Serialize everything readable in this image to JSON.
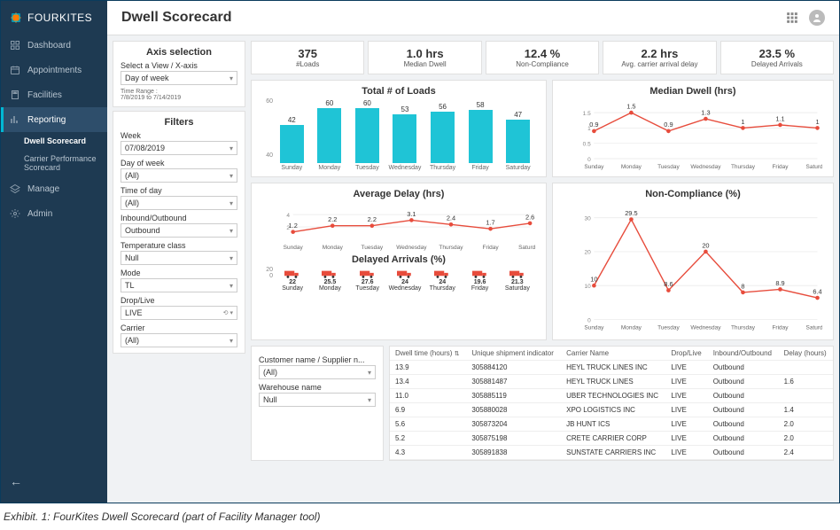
{
  "brand": "FOURKITES",
  "header": {
    "title": "Dwell Scorecard"
  },
  "nav": {
    "items": [
      {
        "label": "Dashboard",
        "icon": "dashboard"
      },
      {
        "label": "Appointments",
        "icon": "calendar"
      },
      {
        "label": "Facilities",
        "icon": "building"
      },
      {
        "label": "Reporting",
        "icon": "chart",
        "active": true
      },
      {
        "label": "Manage",
        "icon": "layers"
      },
      {
        "label": "Admin",
        "icon": "gear"
      }
    ],
    "sub_reporting": [
      {
        "label": "Dwell Scorecard",
        "active": true
      },
      {
        "label": "Carrier Performance Scorecard"
      }
    ]
  },
  "axis": {
    "title": "Axis selection",
    "view_label": "Select a View / X-axis",
    "view_value": "Day of week",
    "time_range_label": "Time Range :",
    "time_range_value": "7/8/2019 to 7/14/2019"
  },
  "filters": {
    "title": "Filters",
    "week_label": "Week",
    "week_value": "07/08/2019",
    "dow_label": "Day of week",
    "dow_value": "(All)",
    "tod_label": "Time of day",
    "tod_value": "(All)",
    "io_label": "Inbound/Outbound",
    "io_value": "Outbound",
    "temp_label": "Temperature class",
    "temp_value": "Null",
    "mode_label": "Mode",
    "mode_value": "TL",
    "dl_label": "Drop/Live",
    "dl_value": "LIVE",
    "carrier_label": "Carrier",
    "carrier_value": "(All)",
    "cust_label": "Customer name / Supplier n...",
    "cust_value": "(All)",
    "wh_label": "Warehouse name",
    "wh_value": "Null"
  },
  "kpis": [
    {
      "value": "375",
      "label": "#Loads"
    },
    {
      "value": "1.0 hrs",
      "label": "Median Dwell"
    },
    {
      "value": "12.4 %",
      "label": "Non-Compliance"
    },
    {
      "value": "2.2 hrs",
      "label": "Avg. carrier arrival delay"
    },
    {
      "value": "23.5 %",
      "label": "Delayed Arrivals"
    }
  ],
  "chart_data": [
    {
      "id": "loads",
      "type": "bar",
      "title": "Total # of Loads",
      "categories": [
        "Sunday",
        "Monday",
        "Tuesday",
        "Wednesday",
        "Thursday",
        "Friday",
        "Saturday"
      ],
      "values": [
        42,
        60,
        60,
        53,
        56,
        58,
        47
      ],
      "ylim": [
        0,
        60
      ],
      "yticks": [
        60,
        40
      ]
    },
    {
      "id": "median_dwell",
      "type": "line",
      "title": "Median Dwell (hrs)",
      "categories": [
        "Sunday",
        "Monday",
        "Tuesday",
        "Wednesday",
        "Thursday",
        "Friday",
        "Saturday"
      ],
      "values": [
        0.9,
        1.5,
        0.9,
        1.3,
        1.0,
        1.1,
        1.0
      ],
      "ylim": [
        0,
        1.5
      ],
      "yticks": [
        1.5,
        1.0,
        0.5,
        0.0
      ]
    },
    {
      "id": "avg_delay",
      "type": "line",
      "title": "Average Delay (hrs)",
      "categories": [
        "Sunday",
        "Monday",
        "Tuesday",
        "Wednesday",
        "Thursday",
        "Friday",
        "Saturday"
      ],
      "values": [
        1.2,
        2.2,
        2.2,
        3.1,
        2.4,
        1.7,
        2.6
      ],
      "ylim": [
        0,
        4
      ],
      "yticks": [
        4,
        2
      ]
    },
    {
      "id": "noncompliance",
      "type": "line",
      "title": "Non-Compliance (%)",
      "categories": [
        "Sunday",
        "Monday",
        "Tuesday",
        "Wednesday",
        "Thursday",
        "Friday",
        "Saturday"
      ],
      "values": [
        10.0,
        29.5,
        8.6,
        20.0,
        8.0,
        8.9,
        6.4
      ],
      "ylim": [
        0,
        30
      ],
      "yticks": [
        30,
        20,
        10,
        0
      ]
    },
    {
      "id": "delayed_arrivals",
      "type": "icon-bar",
      "title": "Delayed Arrivals (%)",
      "categories": [
        "Sunday",
        "Monday",
        "Tuesday",
        "Wednesday",
        "Thursday",
        "Friday",
        "Saturday"
      ],
      "values": [
        22.0,
        25.5,
        27.6,
        24.0,
        24.0,
        19.6,
        21.3
      ],
      "yticks": [
        20,
        0
      ]
    }
  ],
  "table": {
    "columns": [
      "Dwell time (hours)",
      "Unique shipment indicator",
      "Carrier Name",
      "Drop/Live",
      "Inbound/Outbound",
      "Delay (hours)"
    ],
    "rows": [
      [
        "13.9",
        "305884120",
        "HEYL TRUCK LINES INC",
        "LIVE",
        "Outbound",
        ""
      ],
      [
        "13.4",
        "305881487",
        "HEYL TRUCK LINES",
        "LIVE",
        "Outbound",
        "1.6"
      ],
      [
        "11.0",
        "305885119",
        "UBER TECHNOLOGIES INC",
        "LIVE",
        "Outbound",
        ""
      ],
      [
        "6.9",
        "305880028",
        "XPO LOGISTICS INC",
        "LIVE",
        "Outbound",
        "1.4"
      ],
      [
        "5.6",
        "305873204",
        "JB HUNT ICS",
        "LIVE",
        "Outbound",
        "2.0"
      ],
      [
        "5.2",
        "305875198",
        "CRETE CARRIER CORP",
        "LIVE",
        "Outbound",
        "2.0"
      ],
      [
        "4.3",
        "305891838",
        "SUNSTATE CARRIERS INC",
        "LIVE",
        "Outbound",
        "2.4"
      ]
    ]
  },
  "caption": "Exhibit. 1: FourKites Dwell Scorecard (part of Facility Manager tool)"
}
